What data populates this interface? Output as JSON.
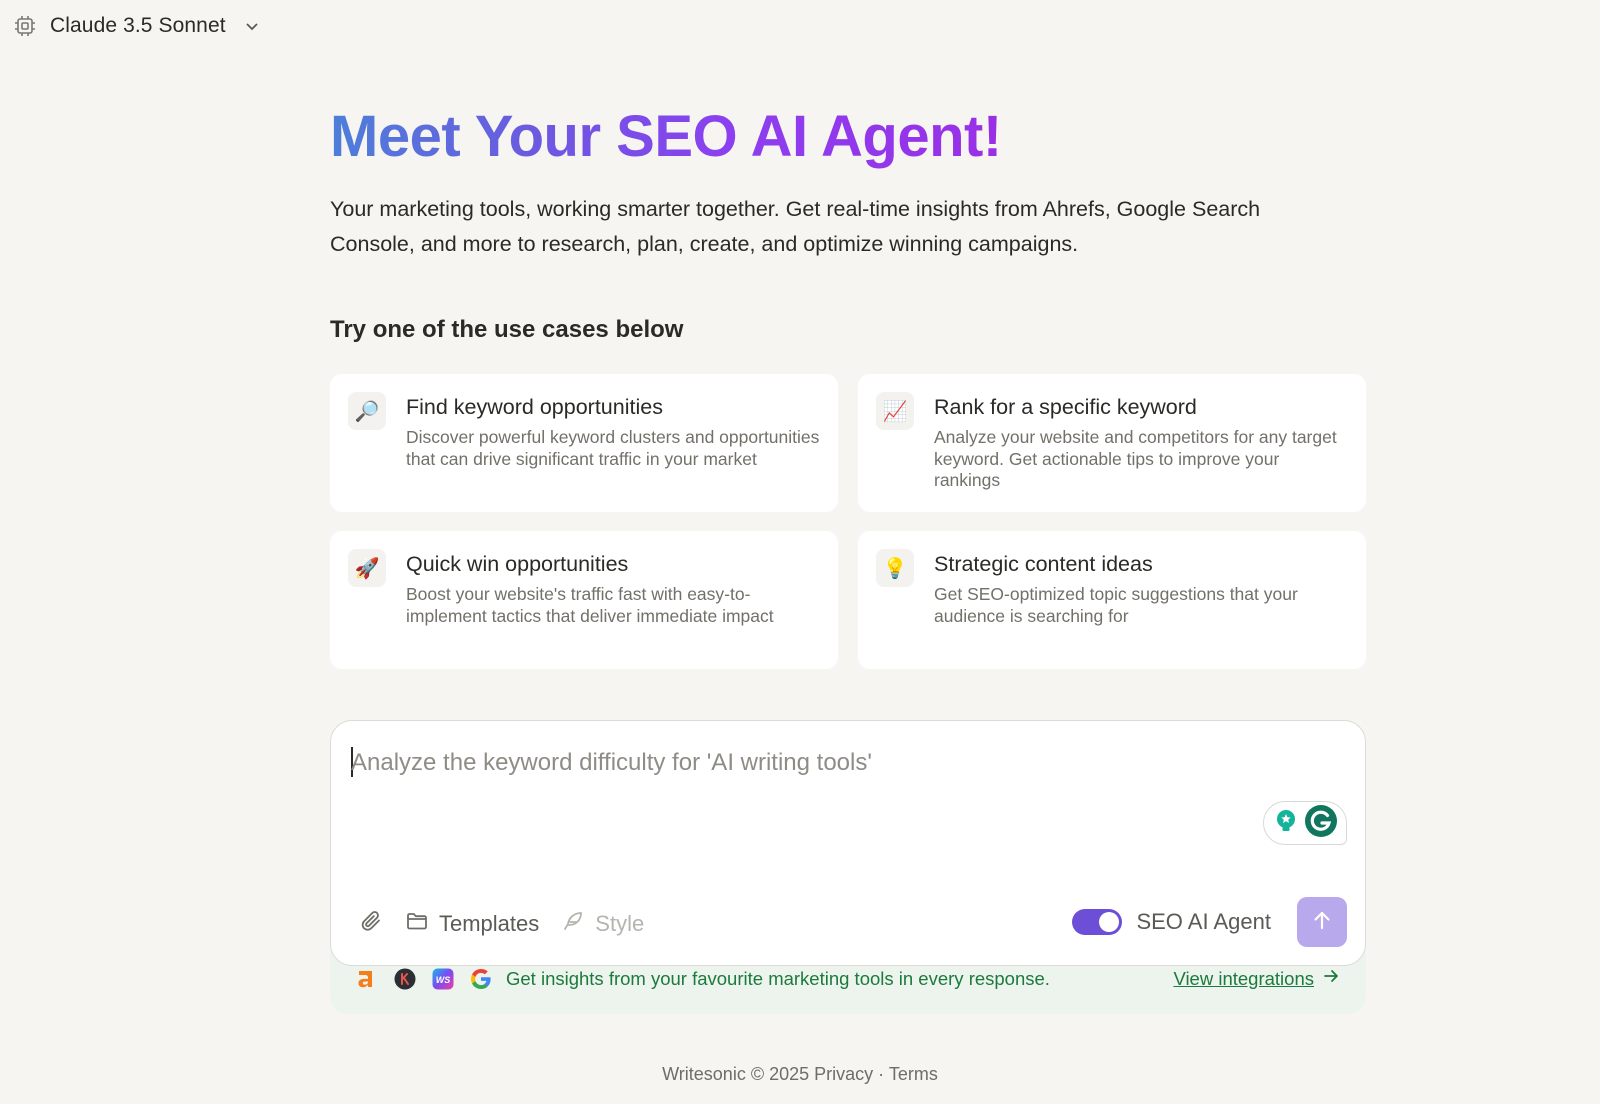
{
  "model_selector": {
    "label": "Claude 3.5 Sonnet",
    "icon": "cpu-chip-icon"
  },
  "hero": {
    "title": "Meet Your SEO AI Agent!",
    "subtitle": "Your marketing tools, working smarter together. Get real-time insights from Ahrefs, Google Search Console, and more to research, plan, create, and optimize winning campaigns."
  },
  "use_cases": {
    "heading": "Try one of the use cases below",
    "items": [
      {
        "icon": "🔎",
        "icon_name": "magnifier-icon",
        "title": "Find keyword opportunities",
        "description": "Discover powerful keyword clusters and opportunities that can drive significant traffic in your market"
      },
      {
        "icon": "📈",
        "icon_name": "chart-up-icon",
        "title": "Rank for a specific keyword",
        "description": "Analyze your website and competitors for any target keyword. Get actionable tips to improve your rankings"
      },
      {
        "icon": "🚀",
        "icon_name": "rocket-icon",
        "title": "Quick win opportunities",
        "description": "Boost your website's traffic fast with easy-to-implement tactics that deliver immediate impact"
      },
      {
        "icon": "💡",
        "icon_name": "lightbulb-icon",
        "title": "Strategic content ideas",
        "description": "Get SEO-optimized topic suggestions that your audience is searching for"
      }
    ]
  },
  "composer": {
    "placeholder": "Analyze the keyword difficulty for 'AI writing tools'",
    "value": "",
    "templates_label": "Templates",
    "style_label": "Style",
    "agent_toggle_label": "SEO AI Agent",
    "agent_toggle_on": true
  },
  "integrations": {
    "icons": [
      "ahrefs-icon",
      "k-icon",
      "ws-icon",
      "google-icon"
    ],
    "text": "Get insights from your favourite marketing tools in every response.",
    "link_label": "View integrations"
  },
  "footer": {
    "brand": "Writesonic © 2025",
    "privacy": "Privacy",
    "separator": "·",
    "terms": "Terms"
  },
  "colors": {
    "accent": "#6c4fd6",
    "send_button": "#b8a8ec",
    "integration_green": "#1c7a3c",
    "background": "#f6f5f1"
  }
}
